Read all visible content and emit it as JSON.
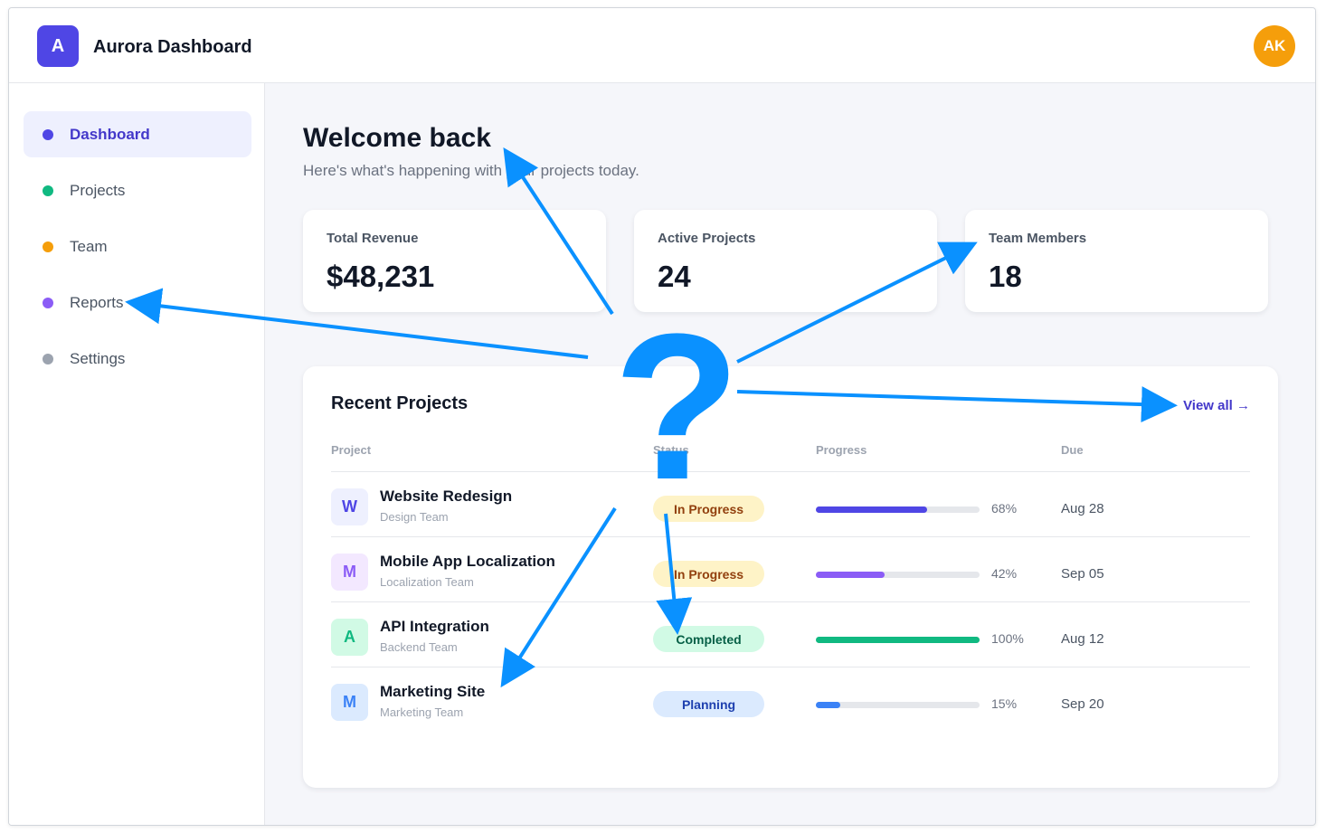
{
  "app": {
    "logo_letter": "A",
    "title": "Aurora Dashboard",
    "avatar_initials": "AK",
    "brand_color": "#4f46e5",
    "avatar_color": "#f59e0b"
  },
  "sidebar": {
    "items": [
      {
        "label": "Dashboard",
        "dot_color": "#4f46e5",
        "active": true
      },
      {
        "label": "Projects",
        "dot_color": "#10b981",
        "active": false
      },
      {
        "label": "Team",
        "dot_color": "#f59e0b",
        "active": false
      },
      {
        "label": "Reports",
        "dot_color": "#8b5cf6",
        "active": false
      },
      {
        "label": "Settings",
        "dot_color": "#9ca3af",
        "active": false
      }
    ]
  },
  "welcome": {
    "title": "Welcome back",
    "subtitle": "Here's what's happening with your projects today."
  },
  "stats": [
    {
      "label": "Total Revenue",
      "value": "$48,231"
    },
    {
      "label": "Active Projects",
      "value": "24"
    },
    {
      "label": "Team Members",
      "value": "18"
    }
  ],
  "recent_projects": {
    "title": "Recent Projects",
    "view_all": "View all →",
    "columns": [
      "Project",
      "Status",
      "Progress",
      "Due"
    ],
    "rows": [
      {
        "initial": "W",
        "name": "Website Redesign",
        "team": "Design Team",
        "status": "In Progress",
        "progress": 68,
        "progress_label": "68%",
        "due": "Aug 28",
        "badge_bg": "#eef0fe",
        "badge_fg": "#4f46e5",
        "status_bg": "#fef3c7",
        "status_fg": "#92400e",
        "bar_color": "#4f46e5"
      },
      {
        "initial": "M",
        "name": "Mobile App Localization",
        "team": "Localization Team",
        "status": "In Progress",
        "progress": 42,
        "progress_label": "42%",
        "due": "Sep 05",
        "badge_bg": "#f3e8ff",
        "badge_fg": "#8b5cf6",
        "status_bg": "#fef3c7",
        "status_fg": "#92400e",
        "bar_color": "#8b5cf6"
      },
      {
        "initial": "A",
        "name": "API Integration",
        "team": "Backend Team",
        "status": "Completed",
        "progress": 100,
        "progress_label": "100%",
        "due": "Aug 12",
        "badge_bg": "#d1fae5",
        "badge_fg": "#10b981",
        "status_bg": "#d1fae5",
        "status_fg": "#065f46",
        "bar_color": "#10b981"
      },
      {
        "initial": "M",
        "name": "Marketing Site",
        "team": "Marketing Team",
        "status": "Planning",
        "progress": 15,
        "progress_label": "15%",
        "due": "Sep 20",
        "badge_bg": "#dbeafe",
        "badge_fg": "#3b82f6",
        "status_bg": "#dbeafe",
        "status_fg": "#1e40af",
        "bar_color": "#3b82f6"
      }
    ]
  },
  "overlay": {
    "symbol": "?",
    "color": "#0a91ff"
  }
}
